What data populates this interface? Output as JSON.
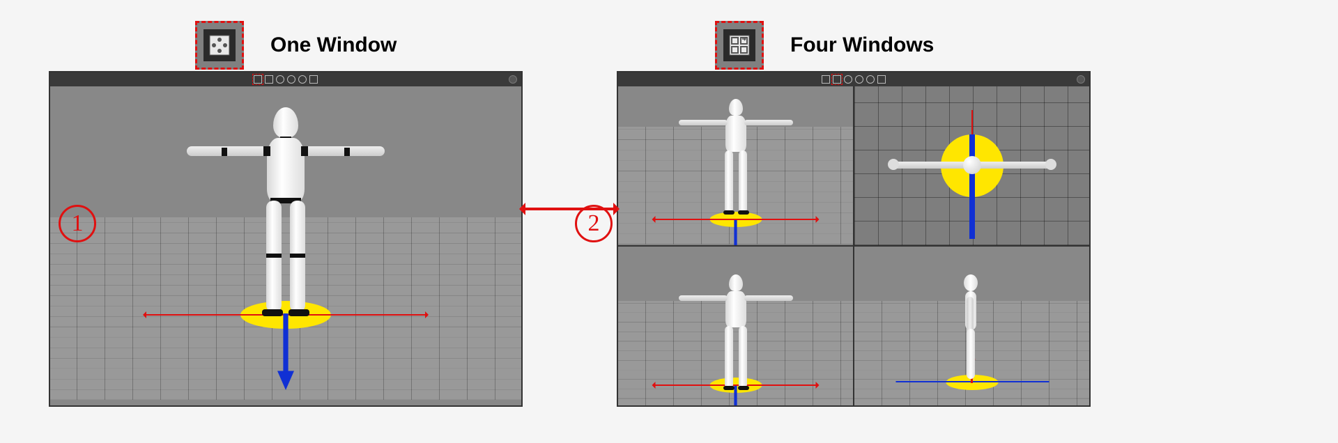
{
  "labels": {
    "one_window": "One Window",
    "four_windows": "Four Windows"
  },
  "markers": {
    "left": "1",
    "right": "2"
  },
  "buttons": {
    "one_window_icon": "single-view-icon",
    "four_windows_icon": "quad-view-icon"
  },
  "toolbar": {
    "icons": [
      "single-view",
      "quad-view",
      "rotate",
      "zoom-extents",
      "zoom-selection",
      "settings"
    ],
    "active_left": "single-view",
    "active_right": "quad-view"
  },
  "views": {
    "single": {
      "type": "perspective",
      "content": "t-pose-mannequin",
      "gizmo": true
    },
    "quad": [
      {
        "position": "top-left",
        "type": "perspective",
        "content": "t-pose-mannequin",
        "gizmo": true
      },
      {
        "position": "top-right",
        "type": "top",
        "content": "t-pose-mannequin-top",
        "gizmo": true
      },
      {
        "position": "bottom-left",
        "type": "front",
        "content": "t-pose-mannequin",
        "gizmo": true
      },
      {
        "position": "bottom-right",
        "type": "side",
        "content": "t-pose-mannequin-side",
        "gizmo": true
      }
    ]
  },
  "gizmo_colors": {
    "x": "#e01010",
    "y": "#ffe600",
    "z": "#1030d4"
  }
}
